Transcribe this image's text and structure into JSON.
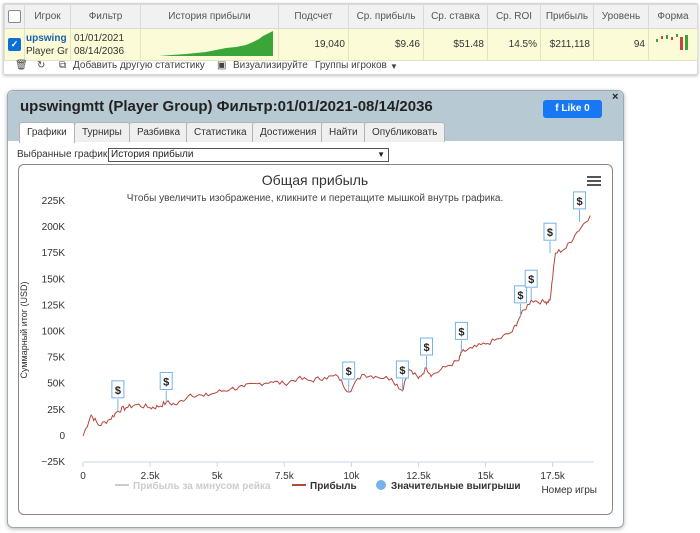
{
  "table": {
    "headers": [
      "Игрок",
      "Фильтр",
      "История прибыли",
      "Подсчет",
      "Ср. прибыль",
      "Ср. ставка",
      "Ср. ROI",
      "Прибыль",
      "Уровень",
      "Форма"
    ],
    "row": {
      "player_line1": "upswing",
      "player_line2": "Player Gr",
      "filter_line1": "01/01/2021",
      "filter_line2": "08/14/2036",
      "count": "19,040",
      "avg_profit": "$9.46",
      "avg_stake": "$51.48",
      "avg_roi": "14.5%",
      "profit": "$211,118",
      "level": "94",
      "remove": "x"
    }
  },
  "toolbar": {
    "add_stat": "Добавить другую статистику",
    "visualize": "Визуализируйте",
    "player_groups": "Группы игроков"
  },
  "dialog": {
    "title": "upswingmtt (Player Group) Фильтр:01/01/2021-08/14/2036",
    "like": "Like 0",
    "close": "×",
    "tabs": [
      "Графики",
      "Турниры",
      "Разбивка",
      "Статистика",
      "Достижения",
      "Найти",
      "Опубликовать"
    ],
    "select_label": "Выбранные графики:",
    "select_value": "История прибыли"
  },
  "colors": {
    "profit_line": "#b5463c",
    "rake_line": "#cccccc",
    "big_win_marker": "#74b3e8",
    "sparkline": "#3aa63a",
    "dialog_header": "#b7c9d3",
    "row_bg": "#fbfbd7"
  },
  "icons": [
    "trash-icon",
    "refresh-icon",
    "copy-icon",
    "image-icon",
    "chevron-down-icon",
    "menu-icon",
    "facebook-icon",
    "close-icon",
    "dollar-icon"
  ],
  "chart_data": {
    "type": "line",
    "title": "Общая прибыль",
    "subtitle": "Чтобы увеличить изображение, кликните и перетащите мышкой внутрь графика.",
    "xlabel": "Номер игры",
    "ylabel": "Суммарный итог (USD)",
    "x_ticks": [
      "0",
      "2.5k",
      "5k",
      "7.5k",
      "10k",
      "12.5k",
      "15k",
      "17.5k"
    ],
    "y_ticks": [
      "225K",
      "200K",
      "175K",
      "150K",
      "125K",
      "100K",
      "75K",
      "50K",
      "25K",
      "0",
      "−25K"
    ],
    "xlim": [
      0,
      19040
    ],
    "ylim": [
      -25000,
      225000
    ],
    "series": [
      {
        "name": "Прибыль за минусом рейка",
        "values": []
      },
      {
        "name": "Прибыль",
        "x": [
          0,
          300,
          600,
          1000,
          1300,
          1600,
          2000,
          2500,
          2800,
          3100,
          3500,
          4000,
          4500,
          5000,
          5500,
          6000,
          6500,
          7000,
          7500,
          8000,
          8500,
          9000,
          9500,
          9900,
          10400,
          10900,
          11500,
          11900,
          12100,
          12500,
          12800,
          13000,
          13500,
          14000,
          14100,
          14500,
          15000,
          15500,
          16000,
          16300,
          16700,
          17200,
          17400,
          17600,
          18000,
          18400,
          18900
        ],
        "y": [
          0,
          20000,
          10000,
          16000,
          24000,
          27000,
          30000,
          27000,
          28000,
          32000,
          30000,
          40000,
          38000,
          42000,
          45000,
          47000,
          50000,
          52000,
          50000,
          55000,
          53000,
          56000,
          57000,
          42000,
          59000,
          57000,
          55000,
          43000,
          65000,
          55000,
          65000,
          58000,
          66000,
          72000,
          80000,
          84000,
          88000,
          93000,
          100000,
          115000,
          130000,
          128000,
          130000,
          175000,
          180000,
          195000,
          211000
        ]
      },
      {
        "name": "Значительные выигрыши",
        "x": [
          1300,
          3100,
          9900,
          11900,
          12800,
          14100,
          16300,
          16700,
          17400,
          18500
        ],
        "y": [
          24000,
          32000,
          42000,
          43000,
          65000,
          80000,
          115000,
          130000,
          175000,
          205000
        ]
      }
    ],
    "marker_label": "$",
    "legend_position": "bottom",
    "grid": false
  }
}
